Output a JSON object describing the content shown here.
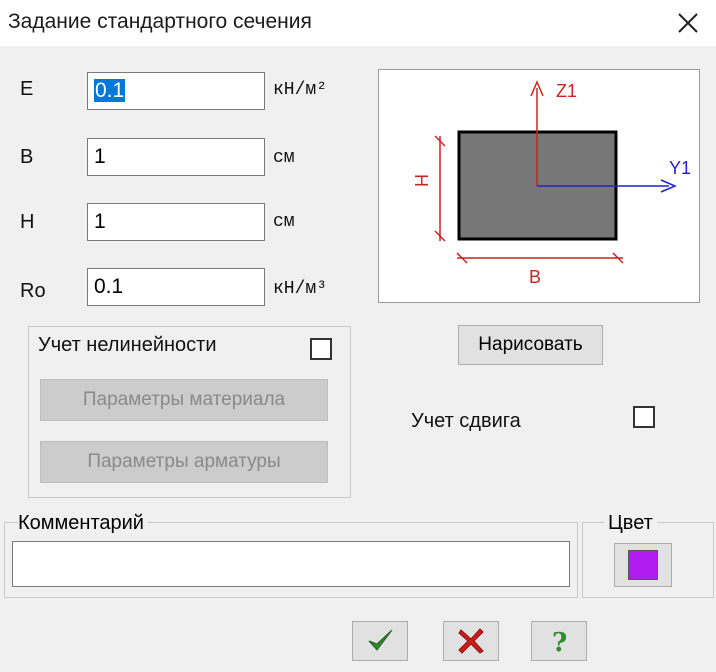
{
  "window": {
    "title": "Задание стандартного сечения",
    "close_icon": "close-icon"
  },
  "fields": [
    {
      "label": "E",
      "value": "0.1",
      "unit": "кН/м²",
      "selected": true
    },
    {
      "label": "B",
      "value": "1",
      "unit": "см",
      "selected": false
    },
    {
      "label": "H",
      "value": "1",
      "unit": "см",
      "selected": false
    },
    {
      "label": "Ro",
      "value": "0.1",
      "unit": "кН/м³",
      "selected": false
    }
  ],
  "preview": {
    "axis_z": "Z1",
    "axis_y": "Y1",
    "dim_h": "H",
    "dim_b": "B",
    "section_fill": "#777777",
    "axis_z_color": "#cc2222",
    "axis_y_color": "#2222cc"
  },
  "nonlinear": {
    "label": "Учет нелинейности",
    "checked": false,
    "material_button": "Параметры материала",
    "reinforcement_button": "Параметры арматуры"
  },
  "draw_button": "Нарисовать",
  "shear": {
    "label": "Учет сдвига",
    "checked": false
  },
  "comment": {
    "label": "Комментарий",
    "value": ""
  },
  "color": {
    "label": "Цвет",
    "value": "#b01cf0"
  },
  "buttons": {
    "ok_icon": "checkmark-icon",
    "cancel_icon": "red-x-icon",
    "help_icon": "question-icon",
    "ok_color": "#2e8b2e",
    "cancel_color": "#d11a1a",
    "help_color": "#2e8b2e"
  }
}
